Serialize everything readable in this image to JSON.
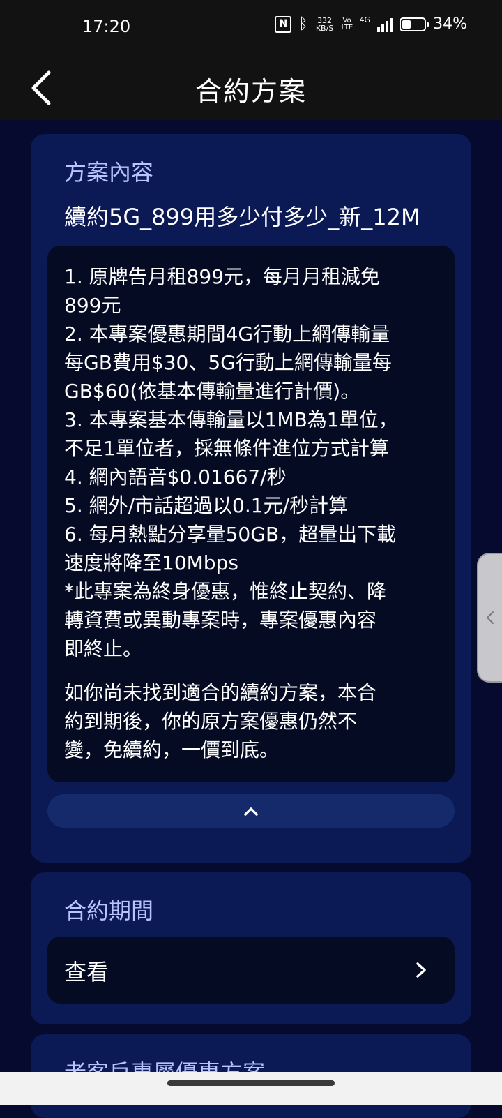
{
  "status_bar": {
    "time": "17:20",
    "battery_text": "34%",
    "battery_level": 0.34,
    "speed_value": "332",
    "speed_unit": "KB/S",
    "volte": "Vo LTE",
    "network": "4G",
    "icons": [
      "nfc-icon",
      "bluetooth-icon",
      "signal-icon",
      "battery-icon"
    ]
  },
  "header": {
    "title": "合約方案",
    "back_icon": "chevron-left"
  },
  "plan_card": {
    "heading": "方案內容",
    "plan_name": "續約5G_899用多少付多少_新_12M",
    "details": [
      "1. 原牌告月租899元，每月月租減免",
      "899元",
      "2. 本專案優惠期間4G行動上網傳輸量",
      "每GB費用$30、5G行動上網傳輸量每",
      "GB$60(依基本傳輸量進行計價)。",
      "3. 本專案基本傳輸量以1MB為1單位，",
      "不足1單位者，採無條件進位方式計算",
      "4. 網內語音$0.01667/秒",
      "5. 網外/市話超過以0.1元/秒計算",
      "6. 每月熱點分享量50GB，超量出下載",
      "速度將降至10Mbps",
      "*此專案為終身優惠，惟終止契約、降",
      "轉資費或異動專案時，專案優惠內容",
      "即終止。"
    ],
    "note": [
      "如你尚未找到適合的續約方案，本合",
      "約到期後，你的原方案優惠仍然不",
      "變，免續約，一價到底。"
    ],
    "collapse_icon": "chevron-up"
  },
  "period_card": {
    "heading": "合約期間",
    "view_label": "查看",
    "view_icon": "chevron-right"
  },
  "next_card": {
    "heading": "老客戶專屬優惠方案"
  },
  "colors": {
    "background": "#050a2e",
    "card": "#0b1a55",
    "inner_box": "#060b24",
    "heading_text": "#b8c3ff",
    "top_bar": "#121212"
  }
}
